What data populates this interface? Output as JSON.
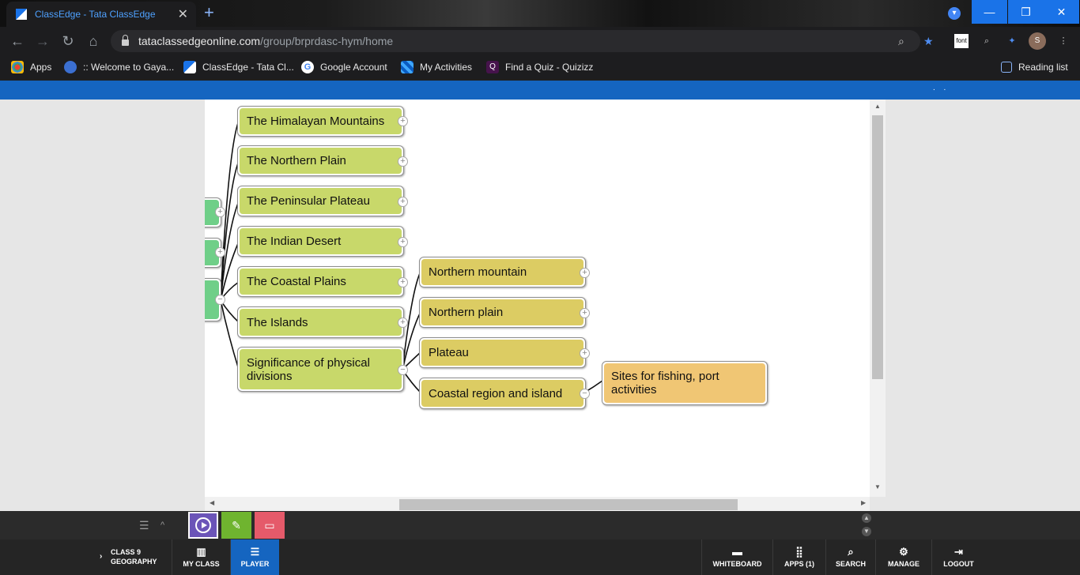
{
  "browser": {
    "tab_title": "ClassEdge - Tata ClassEdge",
    "tab_close": "✕",
    "new_tab": "+",
    "url_host": "tataclassedgeonline.com",
    "url_path": "/group/brprdasc-hym/home",
    "avatar_initial": "S",
    "ext_font_label": "font",
    "window_controls": {
      "minimize": "—",
      "restore": "❐",
      "close": "✕"
    },
    "bookmarks": [
      {
        "label": "Apps",
        "icon": "apps-grid-icon"
      },
      {
        "label": ":: Welcome to Gaya...",
        "icon": "globe-icon"
      },
      {
        "label": "ClassEdge - Tata Cl...",
        "icon": "classedge-icon"
      },
      {
        "label": "Google Account",
        "icon": "google-icon"
      },
      {
        "label": "My Activities",
        "icon": "activities-icon"
      },
      {
        "label": "Find a Quiz - Quizizz",
        "icon": "quizizz-icon"
      }
    ],
    "reading_list": "Reading list"
  },
  "mindmap": {
    "branches": [
      "The Himalayan Mountains",
      "The Northern Plain",
      "The Peninsular Plateau",
      "The Indian Desert",
      "The Coastal Plains",
      "The Islands",
      "Significance of physical divisions"
    ],
    "significance": [
      "Northern mountain",
      "Northern plain",
      "Plateau",
      "Coastal region and island"
    ],
    "coastal_detail": "Sites for fishing, port activities",
    "expand_symbol": "+",
    "collapse_symbol": "−"
  },
  "tray": {
    "outline_icon": "☰",
    "caret": "^",
    "player_icon": "play-icon",
    "notes_icon": "notes-icon",
    "board_icon": "board-icon"
  },
  "footer": {
    "course_line1": "CLASS 9",
    "course_line2": "GEOGRAPHY",
    "my_class": "MY CLASS",
    "player": "PLAYER",
    "whiteboard": "WHITEBOARD",
    "apps": "APPS (1)",
    "search": "SEARCH",
    "manage": "MANAGE",
    "logout": "LOGOUT"
  },
  "colors": {
    "accent": "#1565c0",
    "node_green": "#c8d86a",
    "node_yellow": "#dccc63",
    "node_orange": "#f0c674",
    "root_green": "#6fcf88"
  }
}
